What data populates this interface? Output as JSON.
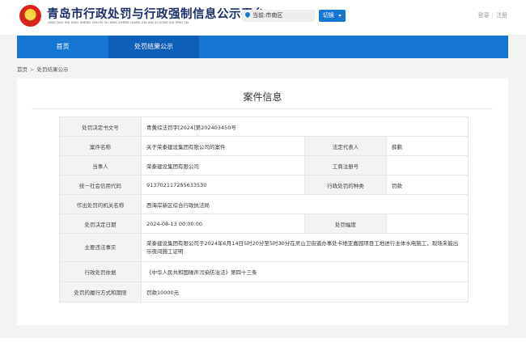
{
  "header": {
    "title": "青岛市行政处罚与行政强制信息公示平台",
    "pinyin": "QING DAO SHI XING ZHENG CHU FA YU XING ZHENG QIANG ZHI XIN XI GONG SHI PING TAI",
    "location": "当前:市南区",
    "switch_label": "切换",
    "login": "登录",
    "register": "注册"
  },
  "nav": {
    "items": [
      {
        "label": "首页"
      },
      {
        "label": "处罚结果公示"
      }
    ]
  },
  "breadcrumb": {
    "home": "首页",
    "separator": ">",
    "current": "处罚结果公示"
  },
  "case": {
    "title": "案件信息",
    "decision_no_label": "处罚决定书文号",
    "decision_no": "青黄综法罚字[2024]第202403450号",
    "case_name_label": "案件名称",
    "case_name": "关于荣泰建设集团有限公司的案件",
    "legal_rep_label": "法定代表人",
    "legal_rep": "薛鹏",
    "party_label": "当事人",
    "party": "荣泰建设集团有限公司",
    "biz_reg_label": "工商注册号",
    "biz_reg": "",
    "credit_code_label": "统一社会信用代码",
    "credit_code": "913702117255633530",
    "penalty_type_label": "行政处罚的种类",
    "penalty_type": "罚款",
    "authority_label": "作出处罚的机关名称",
    "authority": "西海岸新区综合行政执法局",
    "decision_date_label": "处罚决定日期",
    "decision_date": "2024-08-13 00:00:00",
    "penalty_scope_label": "处罚幅度",
    "penalty_scope": "",
    "violation_label": "主要违法事实",
    "violation": "荣泰建设集团有限公司于2024年6月14日5时20分至5时30分在灵山卫街道办事处卡地亚嘉园项目工地进行主体水电施工，现场未能出示夜间施工证明",
    "basis_label": "行政处罚依据",
    "basis": "《中华人民共和国噪声污染防治法》第四十三条",
    "fulfillment_label": "处罚的履行方式和期限",
    "fulfillment": "罚款10000元"
  },
  "colors": {
    "brand_blue": "#1677d2",
    "title_navy": "#1d2f6b"
  }
}
